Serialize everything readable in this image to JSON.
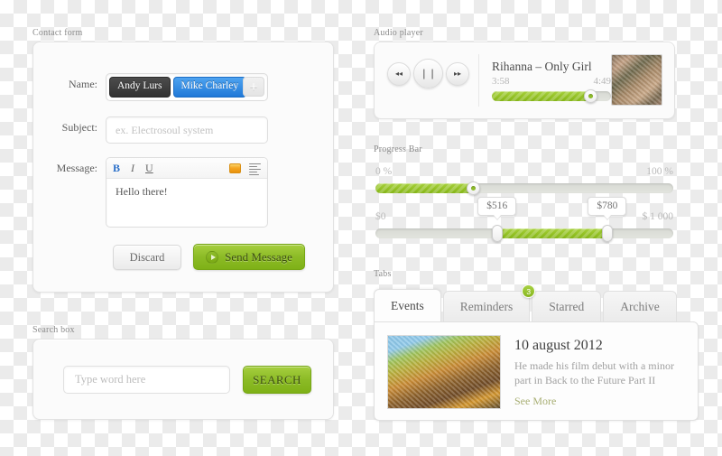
{
  "sections": {
    "contact_form": "Contact form",
    "search_box": "Search box",
    "audio_player": "Audio player",
    "progress_bar": "Progress Bar",
    "tabs": "Tabs"
  },
  "contact_form": {
    "labels": {
      "name": "Name:",
      "subject": "Subject:",
      "message": "Message:"
    },
    "name_tags": [
      {
        "text": "Andy Lurs",
        "style": "dark"
      },
      {
        "text": "Mike Charley",
        "style": "blue"
      }
    ],
    "add_tag_label": "+",
    "subject_value": "",
    "subject_placeholder": "ex. Electrosoul system",
    "toolbar": {
      "bold": "B",
      "italic": "I",
      "underline": "U",
      "color_swatch": "#f5a623",
      "align_icon": "align-list-icon"
    },
    "message_value": "Hello there!",
    "discard_label": "Discard",
    "send_label": "Send Message"
  },
  "search_box": {
    "input_value": "",
    "input_placeholder": "Type word here",
    "button_label": "SEARCH"
  },
  "audio_player": {
    "controls": {
      "rewind": "◂◂",
      "pause": "❘❘",
      "forward": "▸▸"
    },
    "track_title": "Rihanna – Only Girl",
    "current_time": "3:58",
    "total_time": "4:49",
    "progress_percent": 83
  },
  "progress_bar": {
    "single": {
      "min_label": "0 %",
      "max_label": "100 %",
      "value_percent": 33
    },
    "range": {
      "min_label": "$0",
      "max_label": "$ 1 000",
      "low_tooltip": "$516",
      "high_tooltip": "$780",
      "low_percent": 41,
      "high_percent": 78
    }
  },
  "tabs": {
    "items": [
      {
        "label": "Events",
        "active": true,
        "badge": null
      },
      {
        "label": "Reminders",
        "active": false,
        "badge": "3"
      },
      {
        "label": "Starred",
        "active": false,
        "badge": null
      },
      {
        "label": "Archive",
        "active": false,
        "badge": null
      }
    ],
    "content": {
      "thumbnail": "event-photo",
      "heading": "10 august 2012",
      "description": "He made his film debut with a minor part in Back to the Future Part II",
      "more_link": "See More"
    }
  },
  "colors": {
    "green_accent": "#8cbb26",
    "blue_tag": "#2079d8",
    "dark_tag": "#333333",
    "orange_swatch": "#f5a623",
    "badge_green": "#87b61f"
  }
}
